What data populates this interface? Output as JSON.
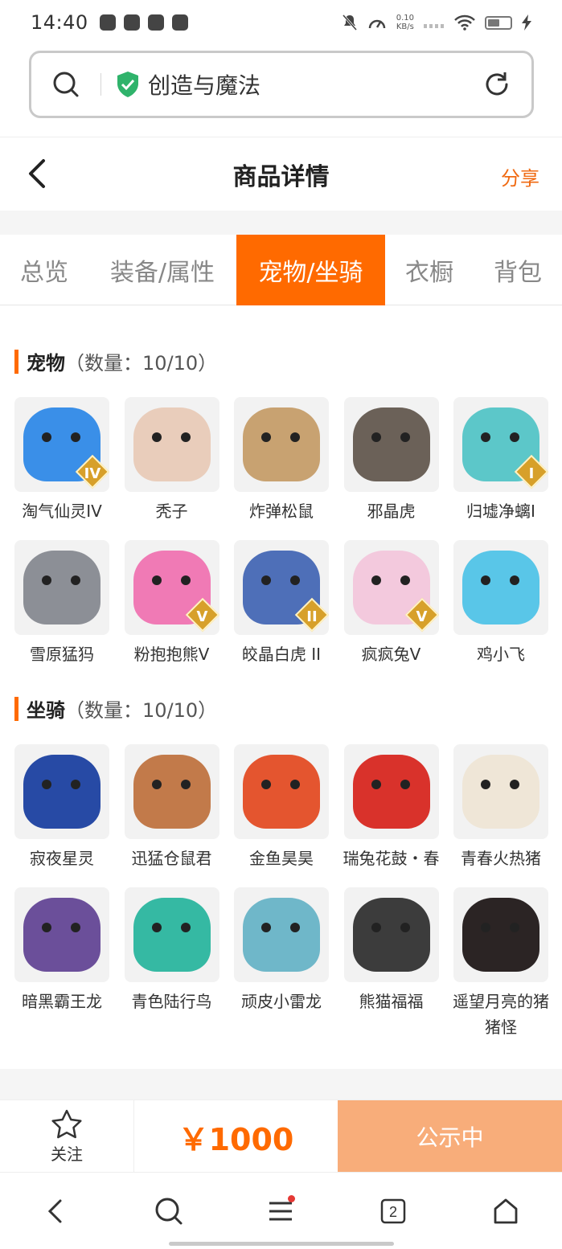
{
  "status_bar": {
    "time": "14:40",
    "net_speed_value": "0.10",
    "net_speed_unit": "KB/s"
  },
  "browser": {
    "search_text": "创造与魔法",
    "icons": [
      "search-icon",
      "shield-check-icon",
      "refresh-icon"
    ]
  },
  "header": {
    "title": "商品详情",
    "share_label": "分享"
  },
  "tabs": [
    {
      "label": "总览",
      "active": false
    },
    {
      "label": "装备/属性",
      "active": false
    },
    {
      "label": "宠物/坐骑",
      "active": true
    },
    {
      "label": "衣橱",
      "active": false
    },
    {
      "label": "背包",
      "active": false
    }
  ],
  "pets": {
    "title": "宠物",
    "count": "（数量：10/10）",
    "items": [
      {
        "name": "淘气仙灵IV",
        "badge": "IV",
        "color": "#3a8fe8"
      },
      {
        "name": "秃子",
        "badge": "",
        "color": "#e9cdbb"
      },
      {
        "name": "炸弹松鼠",
        "badge": "",
        "color": "#c8a271"
      },
      {
        "name": "邪晶虎",
        "badge": "",
        "color": "#6b6158"
      },
      {
        "name": "归墟净螭I",
        "badge": "I",
        "color": "#5cc7c9"
      },
      {
        "name": "雪原猛犸",
        "badge": "",
        "color": "#8c8f96"
      },
      {
        "name": "粉抱抱熊Ⅴ",
        "badge": "V",
        "color": "#f07ab5"
      },
      {
        "name": "皎晶白虎 II",
        "badge": "II",
        "color": "#4e6fb8"
      },
      {
        "name": "疯疯兔V",
        "badge": "V",
        "color": "#f3c9dd"
      },
      {
        "name": "鸡小飞",
        "badge": "",
        "color": "#59c6e8"
      }
    ]
  },
  "mounts": {
    "title": "坐骑",
    "count": "（数量：10/10）",
    "items": [
      {
        "name": "寂夜星灵",
        "color": "#274aa5"
      },
      {
        "name": "迅猛仓鼠君",
        "color": "#c27a4a"
      },
      {
        "name": "金鱼昊昊",
        "color": "#e4552f"
      },
      {
        "name": "瑞兔花鼓・春",
        "color": "#d9322b"
      },
      {
        "name": "青春火热猪",
        "color": "#efe6d7"
      },
      {
        "name": "暗黑霸王龙",
        "color": "#6b4f9a"
      },
      {
        "name": "青色陆行鸟",
        "color": "#35b9a3"
      },
      {
        "name": "顽皮小雷龙",
        "color": "#6fb7c9"
      },
      {
        "name": "熊猫福福",
        "color": "#3c3c3c"
      },
      {
        "name": "遥望月亮的猪猪怪",
        "color": "#2b2424"
      }
    ]
  },
  "action_bar": {
    "follow_label": "关注",
    "price": "￥1000",
    "status_label": "公示中"
  },
  "nav_bar": {
    "tab_count": "2"
  },
  "colors": {
    "accent": "#ff6a00",
    "status_button": "#f8ad7a",
    "share": "#f06a12"
  }
}
